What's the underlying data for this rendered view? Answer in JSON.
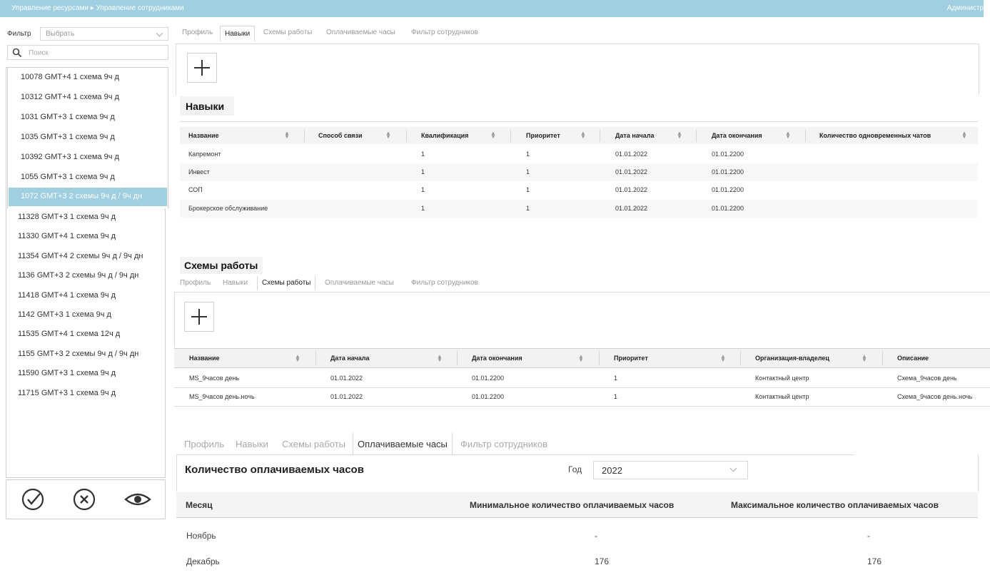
{
  "header": {
    "breadcrumb": "Управление ресурсами ▸ Управление сотрудниками",
    "user": "Администр"
  },
  "sidebar": {
    "filter_label": "Фильтр",
    "filter_value": "Выбрать",
    "search_placeholder": "Поиск",
    "employees": [
      "10078 GMT+4 1 схема 9ч д",
      "10312 GMT+4 1 схема 9ч д",
      "1031 GMT+3 1 схема 9ч д",
      "1035 GMT+3 1 схема 9ч д",
      "10392 GMT+3 1 схема 9ч д",
      "1055 GMT+3 1 схема 9ч д",
      "1072 GMT+3 2 схемы 9ч д / 9ч дн",
      "11328 GMT+3 1 схема 9ч д",
      "11330 GMT+4 1 схема 9ч д",
      "11354 GMT+4 2 схемы 9ч д / 9ч дн",
      "1136 GMT+3 2 схемы 9ч д / 9ч дн",
      "11418 GMT+4 1 схема 9ч д",
      "1142 GMT+3 1 схема 9ч д",
      "11535 GMT+4 1 схема 12ч д",
      "1155 GMT+3 2 схемы 9ч д / 9ч дн",
      "11590 GMT+3 1 схема 9ч д",
      "11715 GMT+3 1 схема 9ч д"
    ],
    "selected_index": 6
  },
  "tabs": [
    "Профиль",
    "Навыки",
    "Схемы работы",
    "Оплачиваемые часы",
    "Фильтр сотрудников"
  ],
  "skills": {
    "title": "Навыки",
    "columns": [
      "Название",
      "Способ связи",
      "Квалификация",
      "Приоритет",
      "Дата начала",
      "Дата окончания",
      "Количество одновременных чатов"
    ],
    "rows": [
      [
        "Капремонт",
        "",
        "1",
        "1",
        "01.01.2022",
        "01.01.2200",
        ""
      ],
      [
        "Инвест",
        "",
        "1",
        "1",
        "01.01.2022",
        "01.01.2200",
        ""
      ],
      [
        "СОП",
        "",
        "1",
        "1",
        "01.01.2022",
        "01.01.2200",
        ""
      ],
      [
        "Брокерское обслуживание",
        "",
        "1",
        "1",
        "01.01.2022",
        "01.01.2200",
        ""
      ]
    ]
  },
  "schemes": {
    "title": "Схемы работы",
    "columns": [
      "Название",
      "Дата начала",
      "Дата окончания",
      "Приоритет",
      "Организация-владелец",
      "Описание"
    ],
    "rows": [
      [
        "MS_9часов день",
        "01.01.2022",
        "01.01.2200",
        "1",
        "Контактный центр",
        "Схема_9часов день"
      ],
      [
        "MS_9часов день.ночь",
        "01.01.2022",
        "01.01.2200",
        "1",
        "Контактный центр",
        "Схема_9часов день.ночь"
      ]
    ]
  },
  "paid_hours": {
    "title": "Количество оплачиваемых часов",
    "year_label": "Год",
    "year_value": "2022",
    "columns": [
      "Месяц",
      "Минимальное количество оплачиваемых часов",
      "Максимальное количество оплачиваемых часов"
    ],
    "rows": [
      [
        "Ноябрь",
        "-",
        "-"
      ],
      [
        "Декабрь",
        "176",
        "176"
      ]
    ]
  },
  "colors": {
    "accent": "#9fcfe0"
  },
  "icons": [
    "search-icon",
    "plus-icon",
    "check-circle-icon",
    "close-circle-icon",
    "eye-icon",
    "sort-icon",
    "chevron-down-icon"
  ]
}
